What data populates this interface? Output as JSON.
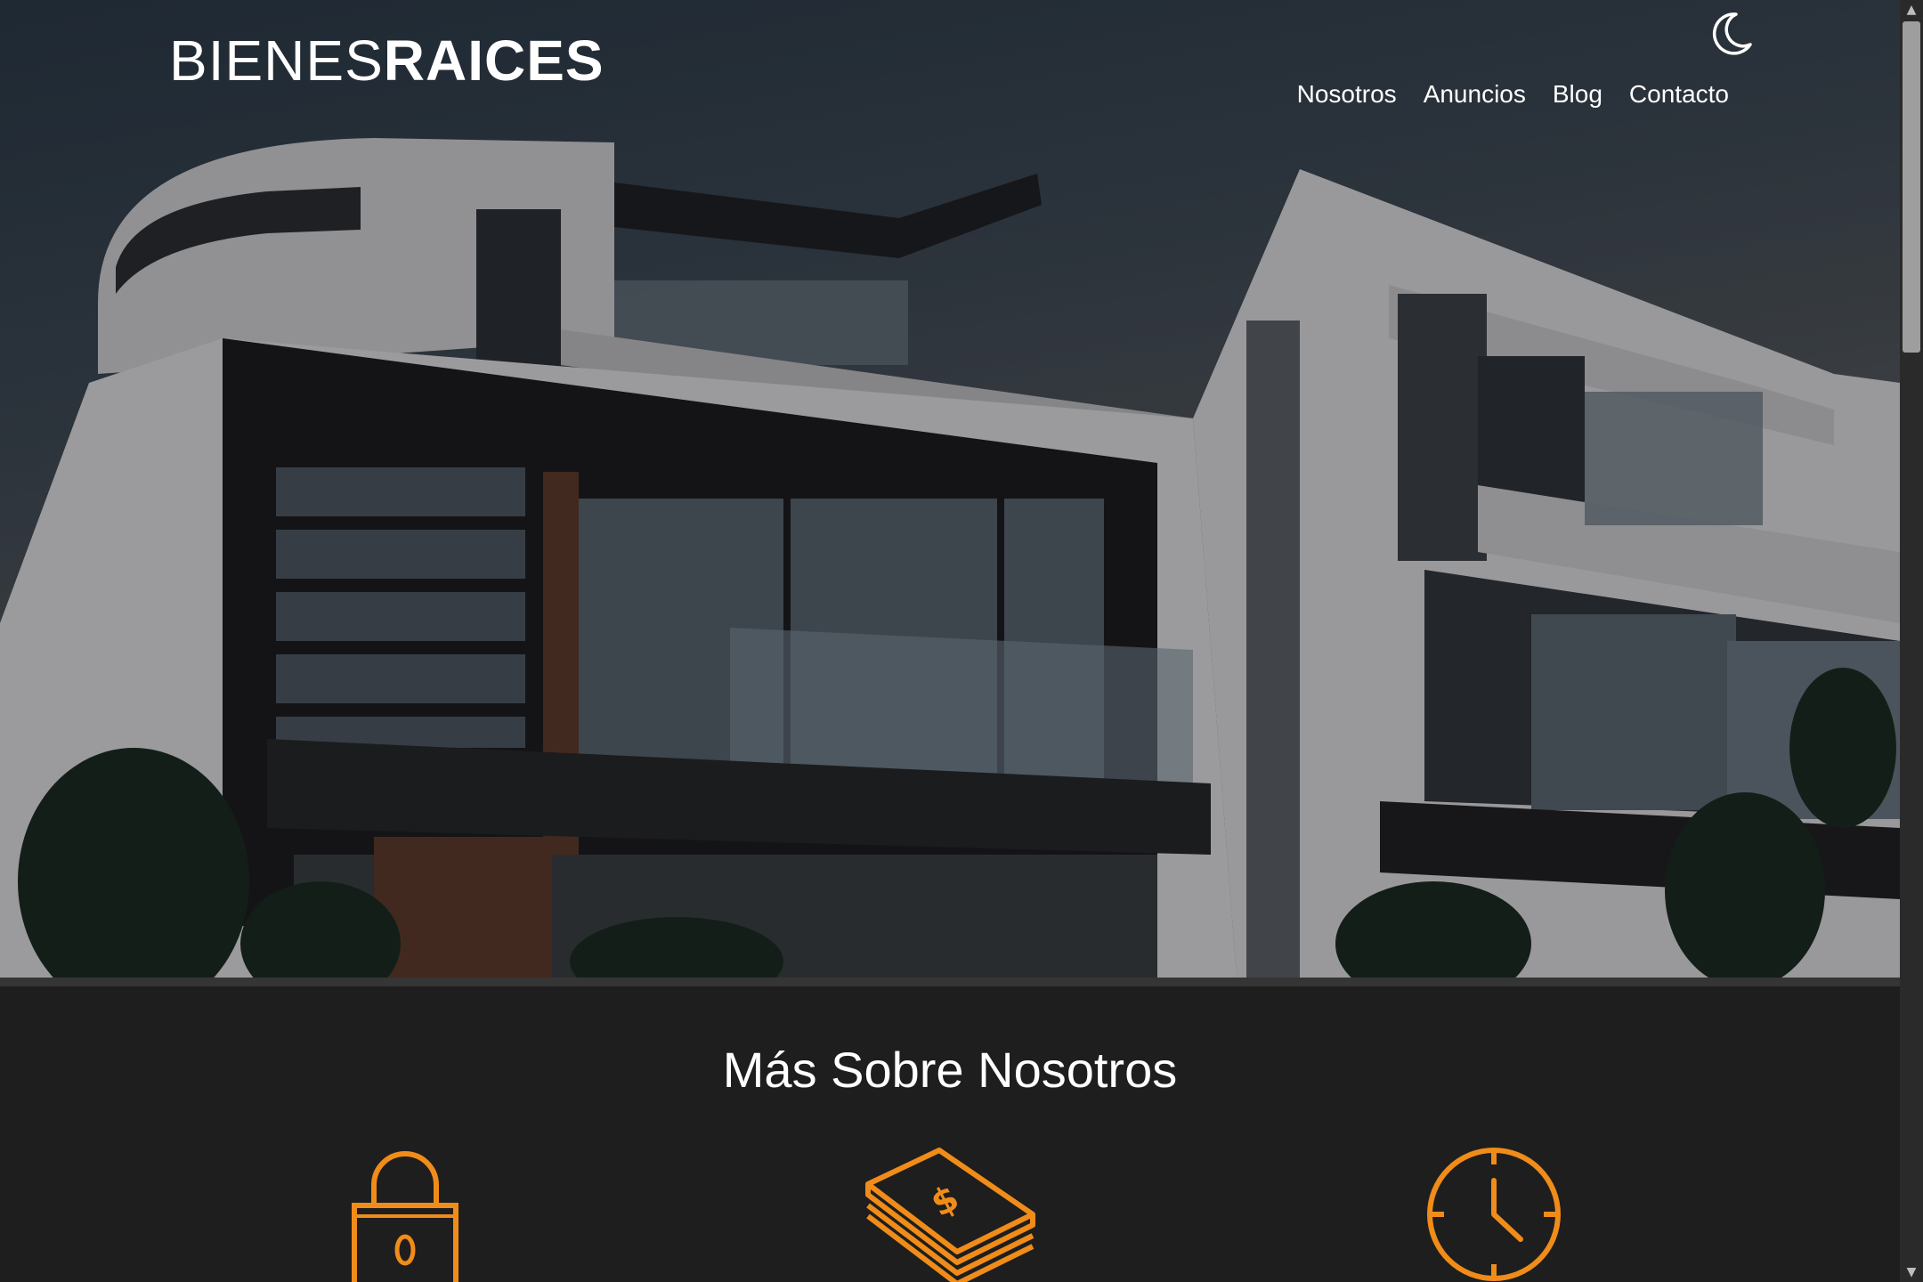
{
  "header": {
    "logo_light": "BIENES",
    "logo_bold": "RAICES",
    "dark_mode_icon": "moon-icon",
    "nav": [
      {
        "label": "Nosotros"
      },
      {
        "label": "Anuncios"
      },
      {
        "label": "Blog"
      },
      {
        "label": "Contacto"
      }
    ]
  },
  "about": {
    "title": "Más Sobre Nosotros",
    "icons": [
      "lock-icon",
      "money-icon",
      "clock-icon"
    ],
    "accent": "#f08c1a"
  },
  "colors": {
    "background": "#1e1e1e",
    "text": "#ffffff",
    "accent": "#f08c1a"
  }
}
